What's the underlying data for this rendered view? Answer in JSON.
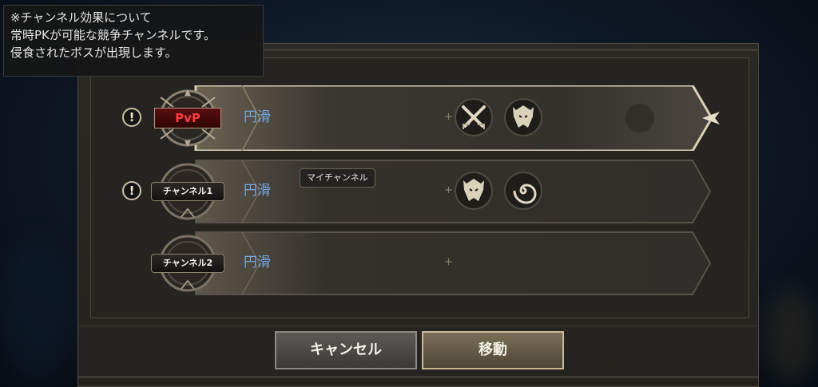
{
  "tooltip": {
    "lines": [
      "※チャンネル効果について",
      "常時PKが可能な競争チャンネルです。",
      "侵食されたボスが出現します。"
    ]
  },
  "channels": [
    {
      "name": "PvP",
      "status": "円滑",
      "warning": "!",
      "selected": true,
      "effect_icons": [
        "crossed-swords-icon",
        "demon-boss-icon"
      ]
    },
    {
      "name": "チャンネル1",
      "status": "円滑",
      "warning": "!",
      "my_channel_tag": "マイチャンネル",
      "effect_icons": [
        "demon-boss-icon",
        "vortex-icon"
      ]
    },
    {
      "name": "チャンネル2",
      "status": "円滑",
      "effect_icons": []
    }
  ],
  "buttons": {
    "cancel": "キャンセル",
    "move": "移動"
  },
  "colors": {
    "status_text": "#74a8e8",
    "pvp_text": "#ff3d3d",
    "selected_border": "#d8cfb4"
  }
}
